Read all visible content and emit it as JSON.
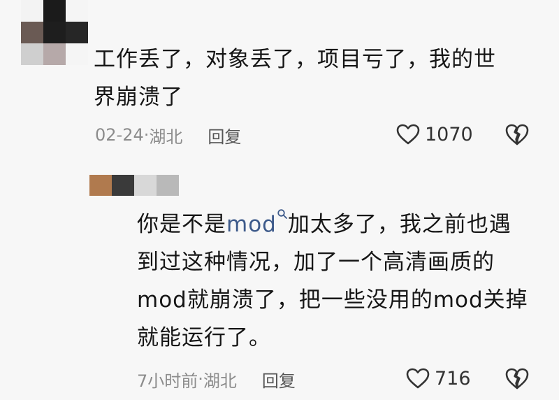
{
  "comments": [
    {
      "avatar_colors": [
        "#f3f3f3",
        "#1b1b1b",
        "#f5f5f5",
        "#6a5a54",
        "#1e1e1e",
        "#262626",
        "#cfcfcf",
        "#b6a9a9",
        "#f5f5f5"
      ],
      "lines": [
        "工作丢了，对象丢了，项目亏了，我的世",
        "界崩溃了"
      ],
      "date": "02-24",
      "location": "湖北",
      "reply_label": "回复",
      "likes": "1070",
      "like_icon": "heart-outline-icon",
      "dislike_icon": "broken-heart-icon"
    },
    {
      "avatar_colors": [
        "#b07a4e",
        "#3a3a3a",
        "#d8d8d8",
        "#b9b9b9"
      ],
      "line1_before": "你是不是",
      "line1_link": "mod",
      "line1_after": "加太多了，我之前也遇",
      "lines_rest": [
        "到过这种情况，加了一个高清画质的",
        "mod就崩溃了，把一些没用的mod关掉",
        "就能运行了。"
      ],
      "date": "7小时前",
      "location": "湖北",
      "reply_label": "回复",
      "likes": "716",
      "like_icon": "heart-outline-icon",
      "dislike_icon": "broken-heart-icon"
    }
  ],
  "colors": {
    "link": "#3d5a8a",
    "meta": "#8c8c8c",
    "text": "#161616"
  },
  "separator": " · "
}
